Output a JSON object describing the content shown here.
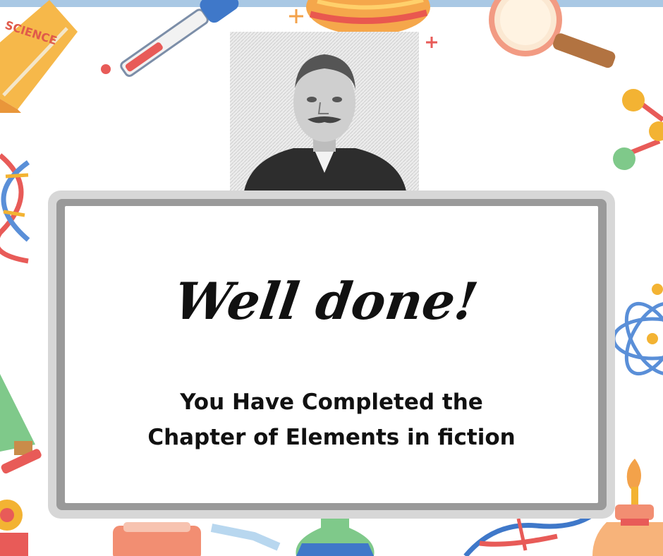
{
  "headline": "Well done!",
  "message": {
    "line1": "You Have Completed the",
    "line2": "Chapter of Elements in fiction"
  },
  "book_label": "SCIENCE",
  "icons": [
    "science-book-icon",
    "dropper-icon",
    "planet-icon",
    "magnifier-icon",
    "molecule-icon",
    "dna-icon",
    "atom-icon",
    "flask-icon",
    "microscope-icon",
    "burner-icon",
    "beaker-icon",
    "sparkle-icon"
  ],
  "colors": {
    "top_bar": "#a9c8e4",
    "board_frame": "#d7d7d7",
    "board_inner": "#9a9a9a",
    "text": "#111111"
  }
}
